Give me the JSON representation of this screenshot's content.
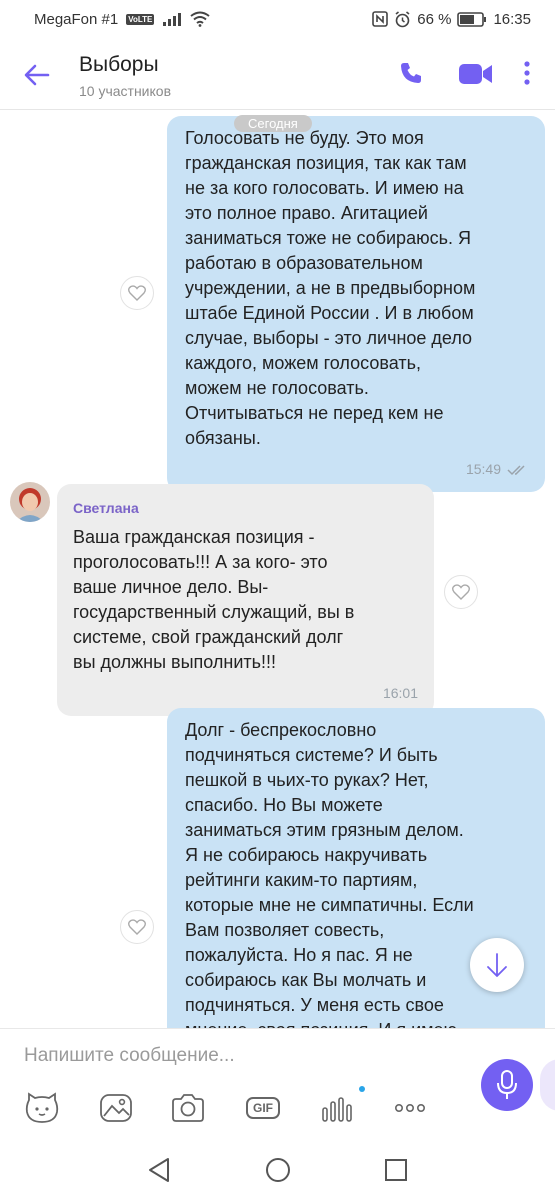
{
  "status_bar": {
    "carrier": "MegaFon #1",
    "volte": "VoLTE",
    "battery": "66 %",
    "time": "16:35"
  },
  "header": {
    "title": "Выборы",
    "subtitle": "10 участников",
    "back_icon": "arrow-left-icon",
    "call_icon": "phone-icon",
    "video_icon": "video-camera-icon",
    "more_icon": "more-vertical-icon",
    "accent_color": "#7360f2"
  },
  "chat": {
    "date_label": "Сегодня",
    "messages": [
      {
        "direction": "out",
        "text": "Голосовать не буду. Это моя\nгражданская позиция, так как там\nне за кого голосовать. И имею на\nэто полное право. Агитацией\nзаниматься тоже не собираюсь. Я\nработаю в образовательном\nучреждении, а не в предвыборном\nштабе Единой России . И в любом\nслучае, выборы - это личное дело\nкаждого, можем голосовать,\nможем не голосовать.\nОтчитываться не перед кем не\nобязаны.",
        "time": "15:49"
      },
      {
        "direction": "in",
        "sender": "Светлана",
        "text": "Ваша гражданская позиция -\nпроголосовать!!! А за кого- это\nваше личное дело. Вы-\nгосударственный служащий, вы в\nсистеме, свой гражданский долг\nвы должны выполнить!!!",
        "time": "16:01"
      },
      {
        "direction": "out",
        "text": "Долг - беспрекословно\nподчиняться системе? И быть\nпешкой в чьих-то руках? Нет,\nспасибо. Но Вы можете\nзаниматься этим грязным делом.\nЯ не собираюсь накручивать\nрейтинги каким-то партиям,\nкоторые мне не симпатичны. Если\nВам позволяет совесть,\nпожалуйста. Но я пас. Я не\nсобираюсь как Вы молчать и\nподчиняться. У меня есть свое\nмнение, своя позиция. И я имею"
      }
    ]
  },
  "composer": {
    "placeholder": "Напишите сообщение...",
    "gif_label": "GIF",
    "tools": [
      "sticker-icon",
      "gallery-icon",
      "camera-icon",
      "gif-icon",
      "audio-waves-icon",
      "more-horizontal-icon"
    ],
    "mic_icon": "microphone-icon"
  },
  "nav": {
    "icons": [
      "nav-back-icon",
      "nav-home-icon",
      "nav-recents-icon"
    ]
  }
}
